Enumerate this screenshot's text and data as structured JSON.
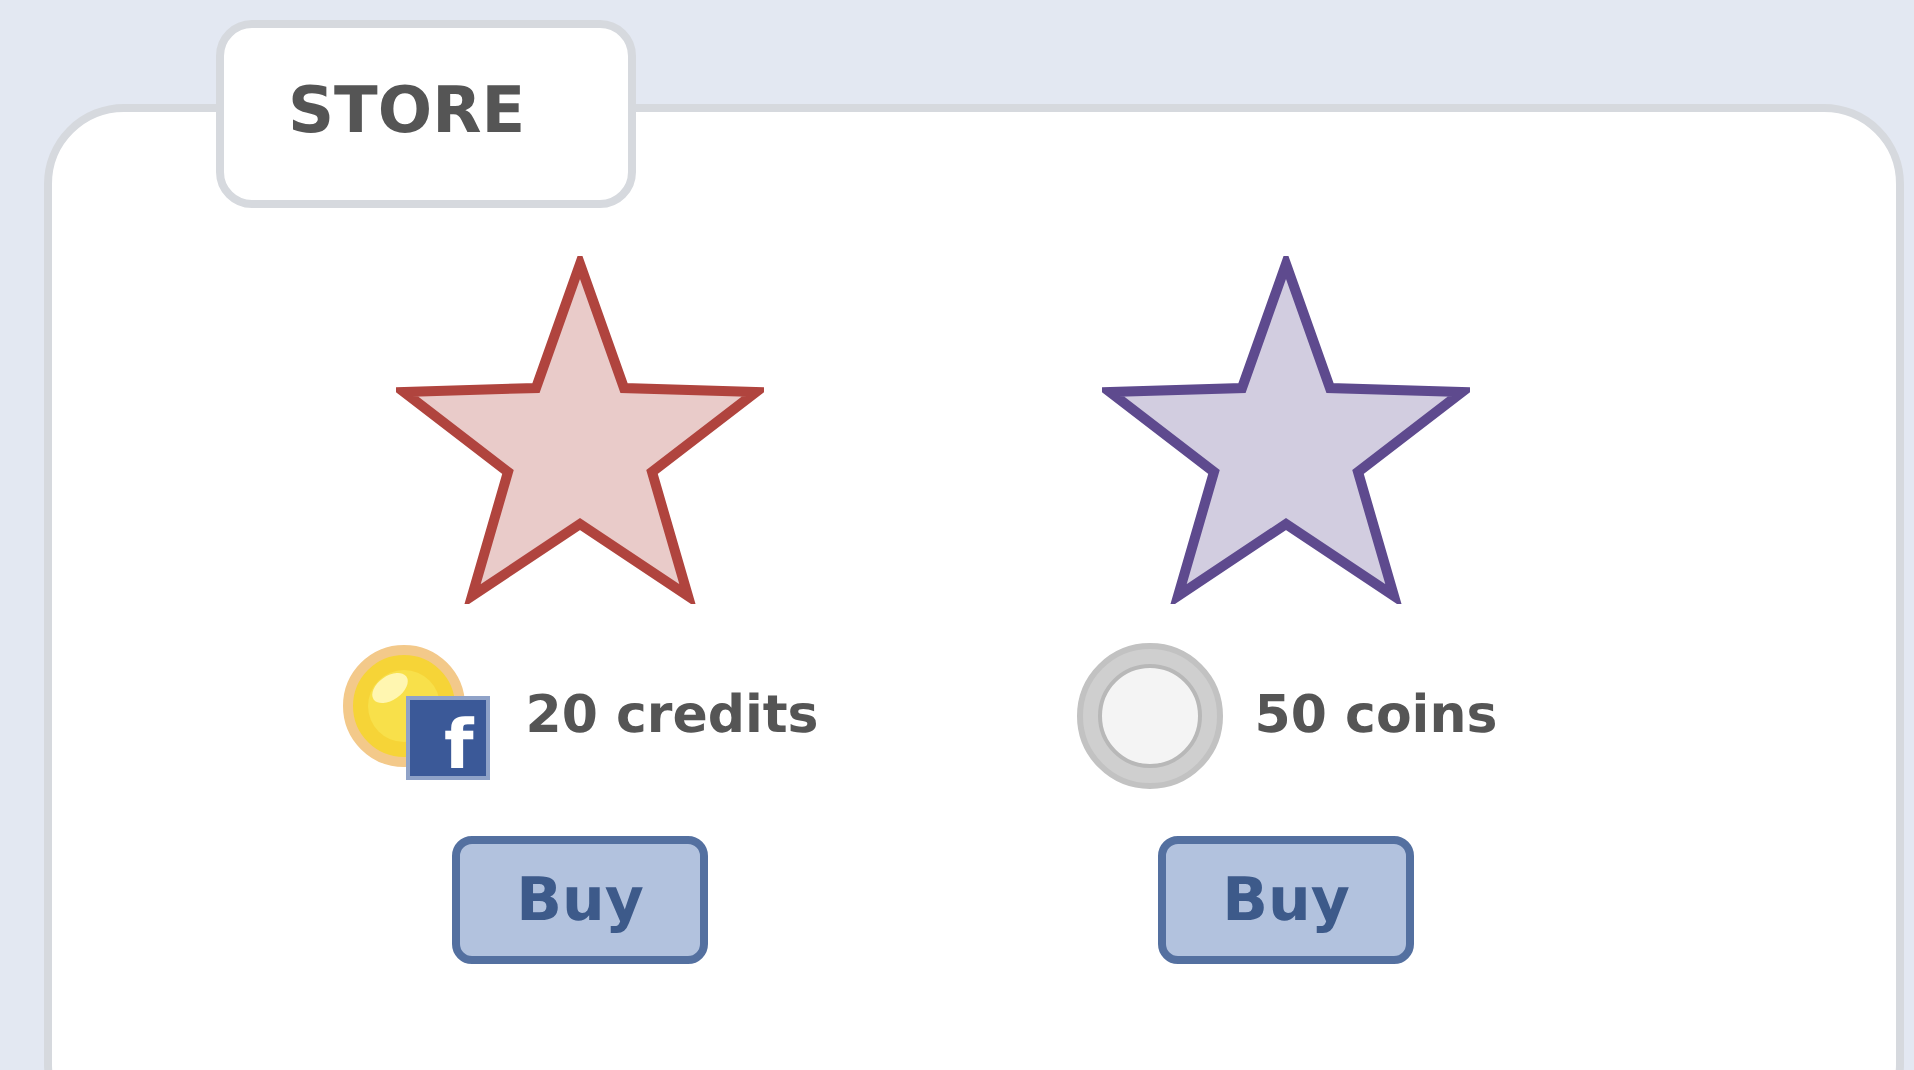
{
  "store": {
    "title": "STORE",
    "items": [
      {
        "kind": "credits",
        "color": "#b0443e",
        "badge": "f",
        "price": "20 credits",
        "button": "Buy"
      },
      {
        "kind": "coins",
        "color": "#5e4a8e",
        "price": "50 coins",
        "button": "Buy"
      }
    ]
  }
}
